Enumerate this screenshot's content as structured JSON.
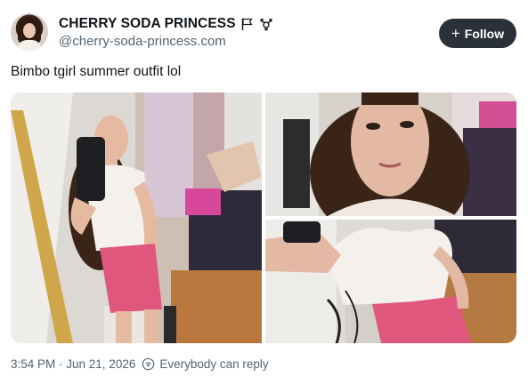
{
  "author": {
    "display_name": "CHERRY SODA PRINCESS",
    "name_emoji": "flag-and-transgender-symbol-icon",
    "handle": "@cherry-soda-princess.com"
  },
  "follow_label": "Follow",
  "post": {
    "text": "Bimbo tgirl summer outfit lol",
    "images": [
      {
        "description": "mirror-selfie-full-outfit"
      },
      {
        "description": "face-close-up-selfie"
      },
      {
        "description": "mirror-selfie-torso-and-shorts"
      }
    ]
  },
  "meta": {
    "timestamp": "3:54 PM · Jun 21, 2026",
    "reply_permission": "Everybody can reply"
  },
  "colors": {
    "follow_bg": "#2b3138",
    "secondary_text": "#536471",
    "shorts_pink": "#e0577e"
  }
}
